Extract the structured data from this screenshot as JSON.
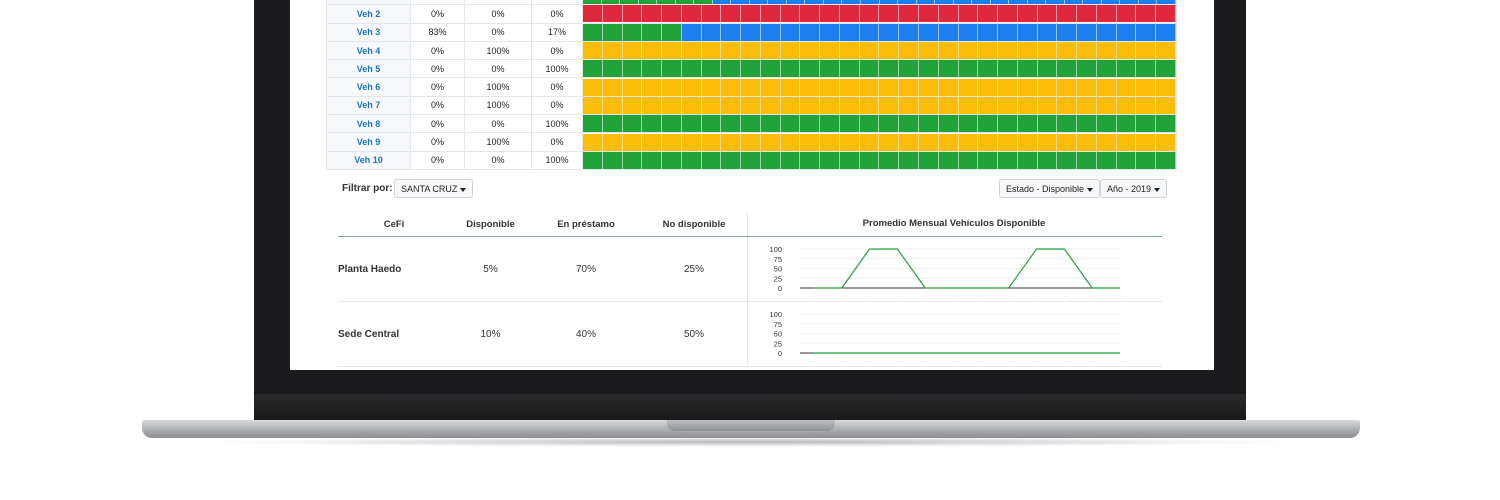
{
  "vehicles": [
    {
      "label": "Veh 2",
      "col1": "0%",
      "col2": "0%",
      "col3": "0%",
      "cells": "rrrrrrrrrrrrrrrrrrrrrrrrrrrrrr"
    },
    {
      "label": "Veh 3",
      "col1": "83%",
      "col2": "0%",
      "col3": "17%",
      "cells": "gggggbbbbbbbbbbbbbbbbbbbbbbbbb"
    },
    {
      "label": "Veh 4",
      "col1": "0%",
      "col2": "100%",
      "col3": "0%",
      "cells": "yyyyyyyyyyyyyyyyyyyyyyyyyyyyyy"
    },
    {
      "label": "Veh 5",
      "col1": "0%",
      "col2": "0%",
      "col3": "100%",
      "cells": "gggggggggggggggggggggggggggggg"
    },
    {
      "label": "Veh 6",
      "col1": "0%",
      "col2": "100%",
      "col3": "0%",
      "cells": "yyyyyyyyyyyyyyyyyyyyyyyyyyyyyy"
    },
    {
      "label": "Veh 7",
      "col1": "0%",
      "col2": "100%",
      "col3": "0%",
      "cells": "yyyyyyyyyyyyyyyyyyyyyyyyyyyyyy"
    },
    {
      "label": "Veh 8",
      "col1": "0%",
      "col2": "0%",
      "col3": "100%",
      "cells": "gggggggggggggggggggggggggggggg"
    },
    {
      "label": "Veh 9",
      "col1": "0%",
      "col2": "100%",
      "col3": "0%",
      "cells": "yyyyyyyyyyyyyyyyyyyyyyyyyyyyyy"
    },
    {
      "label": "Veh 10",
      "col1": "0%",
      "col2": "0%",
      "col3": "100%",
      "cells": "gggggggggggggggggggggggggggggg"
    }
  ],
  "partial_top_row_cells": "gggggggbbbbbbbbbbbbbbbbbbbbbbbbb",
  "colors": {
    "green": "#22a33a",
    "red": "#e0283d",
    "blue": "#1d7ef0",
    "yellow": "#fbbd08"
  },
  "filter": {
    "label": "Filtrar por:",
    "value": "SANTA CRUZ"
  },
  "estado_dropdown": "Estado - Disponible",
  "year_dropdown": "Año - 2019",
  "summary": {
    "headers": {
      "cefi": "CeFi",
      "disponible": "Disponible",
      "prestamo": "En préstamo",
      "no_disponible": "No disponible",
      "chart": "Promedio Mensual Vehículos Disponible"
    },
    "rows": [
      {
        "name": "Planta Haedo",
        "disponible": "5%",
        "prestamo": "70%",
        "no_disponible": "25%"
      },
      {
        "name": "Sede Central",
        "disponible": "10%",
        "prestamo": "40%",
        "no_disponible": "50%"
      }
    ]
  },
  "chart_data": [
    {
      "type": "line",
      "yticks": [
        "100",
        "75",
        "50",
        "25",
        "0"
      ],
      "ylim": [
        0,
        100
      ],
      "x_count": 12,
      "series": [
        {
          "values": [
            0,
            0,
            100,
            100,
            0,
            0,
            0,
            0,
            100,
            100,
            0,
            0
          ]
        }
      ],
      "line_color": "#22a33a"
    },
    {
      "type": "line",
      "yticks": [
        "100",
        "75",
        "50",
        "25",
        "0"
      ],
      "ylim": [
        0,
        100
      ],
      "x_count": 12,
      "series": [
        {
          "values": [
            0,
            0,
            0,
            0,
            0,
            0,
            0,
            0,
            0,
            0,
            0,
            0
          ]
        }
      ],
      "line_color": "#22a33a"
    }
  ]
}
